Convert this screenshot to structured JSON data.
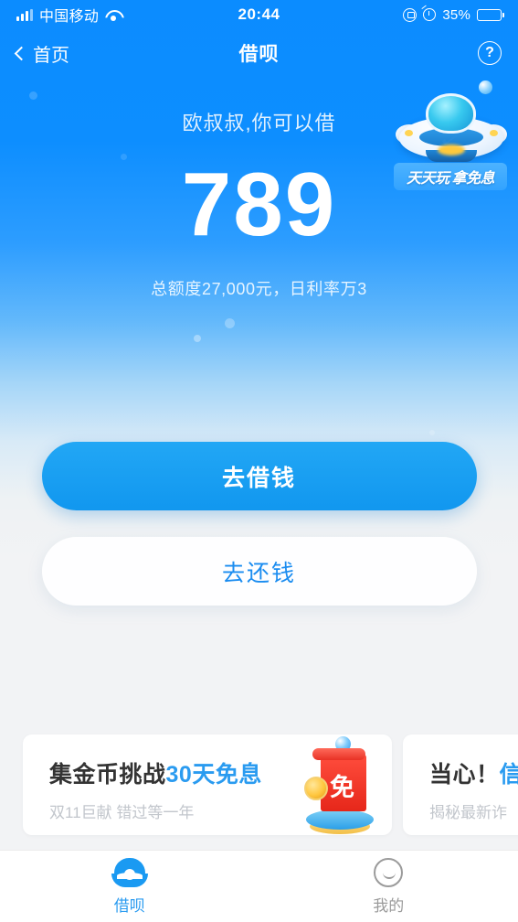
{
  "status_bar": {
    "carrier": "中国移动",
    "time": "20:44",
    "battery_percent": "35%",
    "battery_level": 35,
    "icons": [
      "signal-icon",
      "wifi-icon",
      "rotation-lock-icon",
      "alarm-icon",
      "battery-icon"
    ]
  },
  "nav": {
    "back_label": "首页",
    "title": "借呗",
    "help_label": "?"
  },
  "hero": {
    "greeting": "欧叔叔,你可以借",
    "amount": "789",
    "quota": "总额度27,000元，日利率万3"
  },
  "mascot": {
    "badge_text_1": "天天玩",
    "badge_text_2": "拿免息",
    "icon": "ufo-mascot-icon"
  },
  "actions": {
    "borrow_label": "去借钱",
    "repay_label": "去还钱"
  },
  "cards": [
    {
      "title_plain": "集金币挑战",
      "title_highlight": "30天免息",
      "subtitle": "双11巨献 错过等一年",
      "illustration": "red-envelope-coin-icon",
      "illustration_char": "免"
    },
    {
      "title_plain": "当心！",
      "title_highlight": "信",
      "subtitle": "揭秘最新诈",
      "illustration": "",
      "illustration_char": ""
    }
  ],
  "tabbar": [
    {
      "label": "借呗",
      "icon": "shell-icon",
      "active": true
    },
    {
      "label": "我的",
      "icon": "smiley-face-icon",
      "active": false
    }
  ],
  "colors": {
    "brand_blue": "#1a9af2",
    "hero_top": "#0b8cff",
    "page_bg": "#f2f3f5",
    "muted_text": "#c2c6cc"
  }
}
